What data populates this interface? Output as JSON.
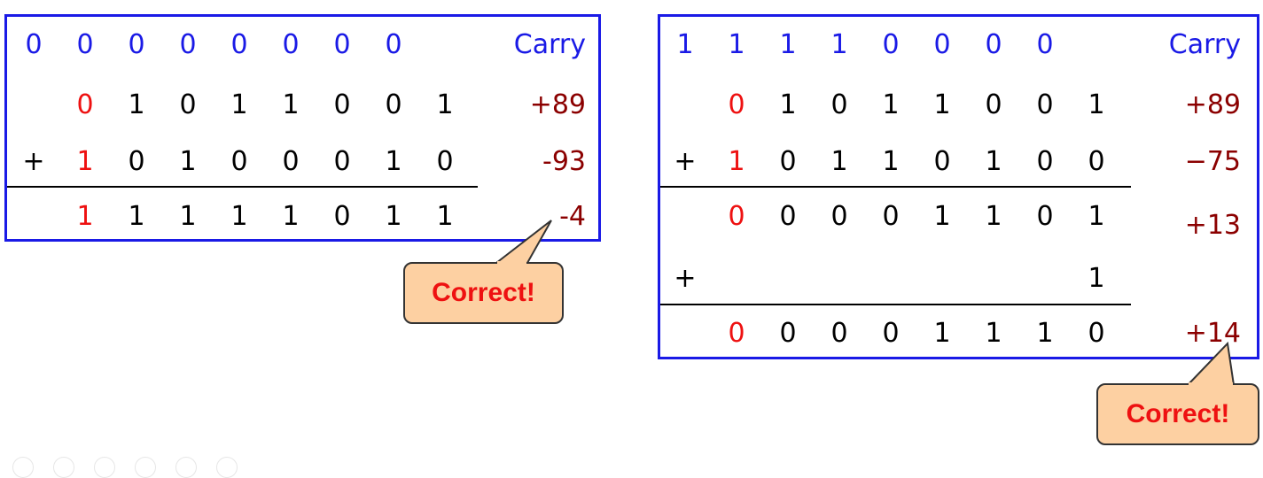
{
  "left_panel": {
    "carry_row": [
      "0",
      "0",
      "0",
      "0",
      "0",
      "0",
      "0",
      "0"
    ],
    "carry_label": "Carry",
    "operand_a": [
      "0",
      "1",
      "0",
      "1",
      "1",
      "0",
      "0",
      "1"
    ],
    "operand_a_decimal": "+89",
    "operator": "+",
    "operand_b": [
      "1",
      "0",
      "1",
      "0",
      "0",
      "0",
      "1",
      "0"
    ],
    "operand_b_decimal": "-93",
    "result": [
      "1",
      "1",
      "1",
      "1",
      "1",
      "0",
      "1",
      "1"
    ],
    "result_decimal": "-4",
    "callout": "Correct!"
  },
  "right_panel": {
    "carry_row": [
      "1",
      "1",
      "1",
      "1",
      "0",
      "0",
      "0",
      "0"
    ],
    "carry_label": "Carry",
    "operand_a": [
      "0",
      "1",
      "0",
      "1",
      "1",
      "0",
      "0",
      "1"
    ],
    "operand_a_decimal": "+89",
    "operator": "+",
    "operand_b": [
      "1",
      "0",
      "1",
      "1",
      "0",
      "1",
      "0",
      "0"
    ],
    "operand_b_decimal": "−75",
    "intermediate": [
      "0",
      "0",
      "0",
      "0",
      "1",
      "1",
      "0",
      "1"
    ],
    "intermediate_decimal": "+13",
    "end_around_operator": "+",
    "end_around_carry": "1",
    "result": [
      "0",
      "0",
      "0",
      "0",
      "1",
      "1",
      "1",
      "0"
    ],
    "result_decimal": "+14",
    "callout": "Correct!"
  },
  "colors": {
    "border": "#1a1ae6",
    "sign_bit": "#ee1111",
    "decimal": "#8b0000",
    "callout_fill": "#fdd0a2"
  }
}
